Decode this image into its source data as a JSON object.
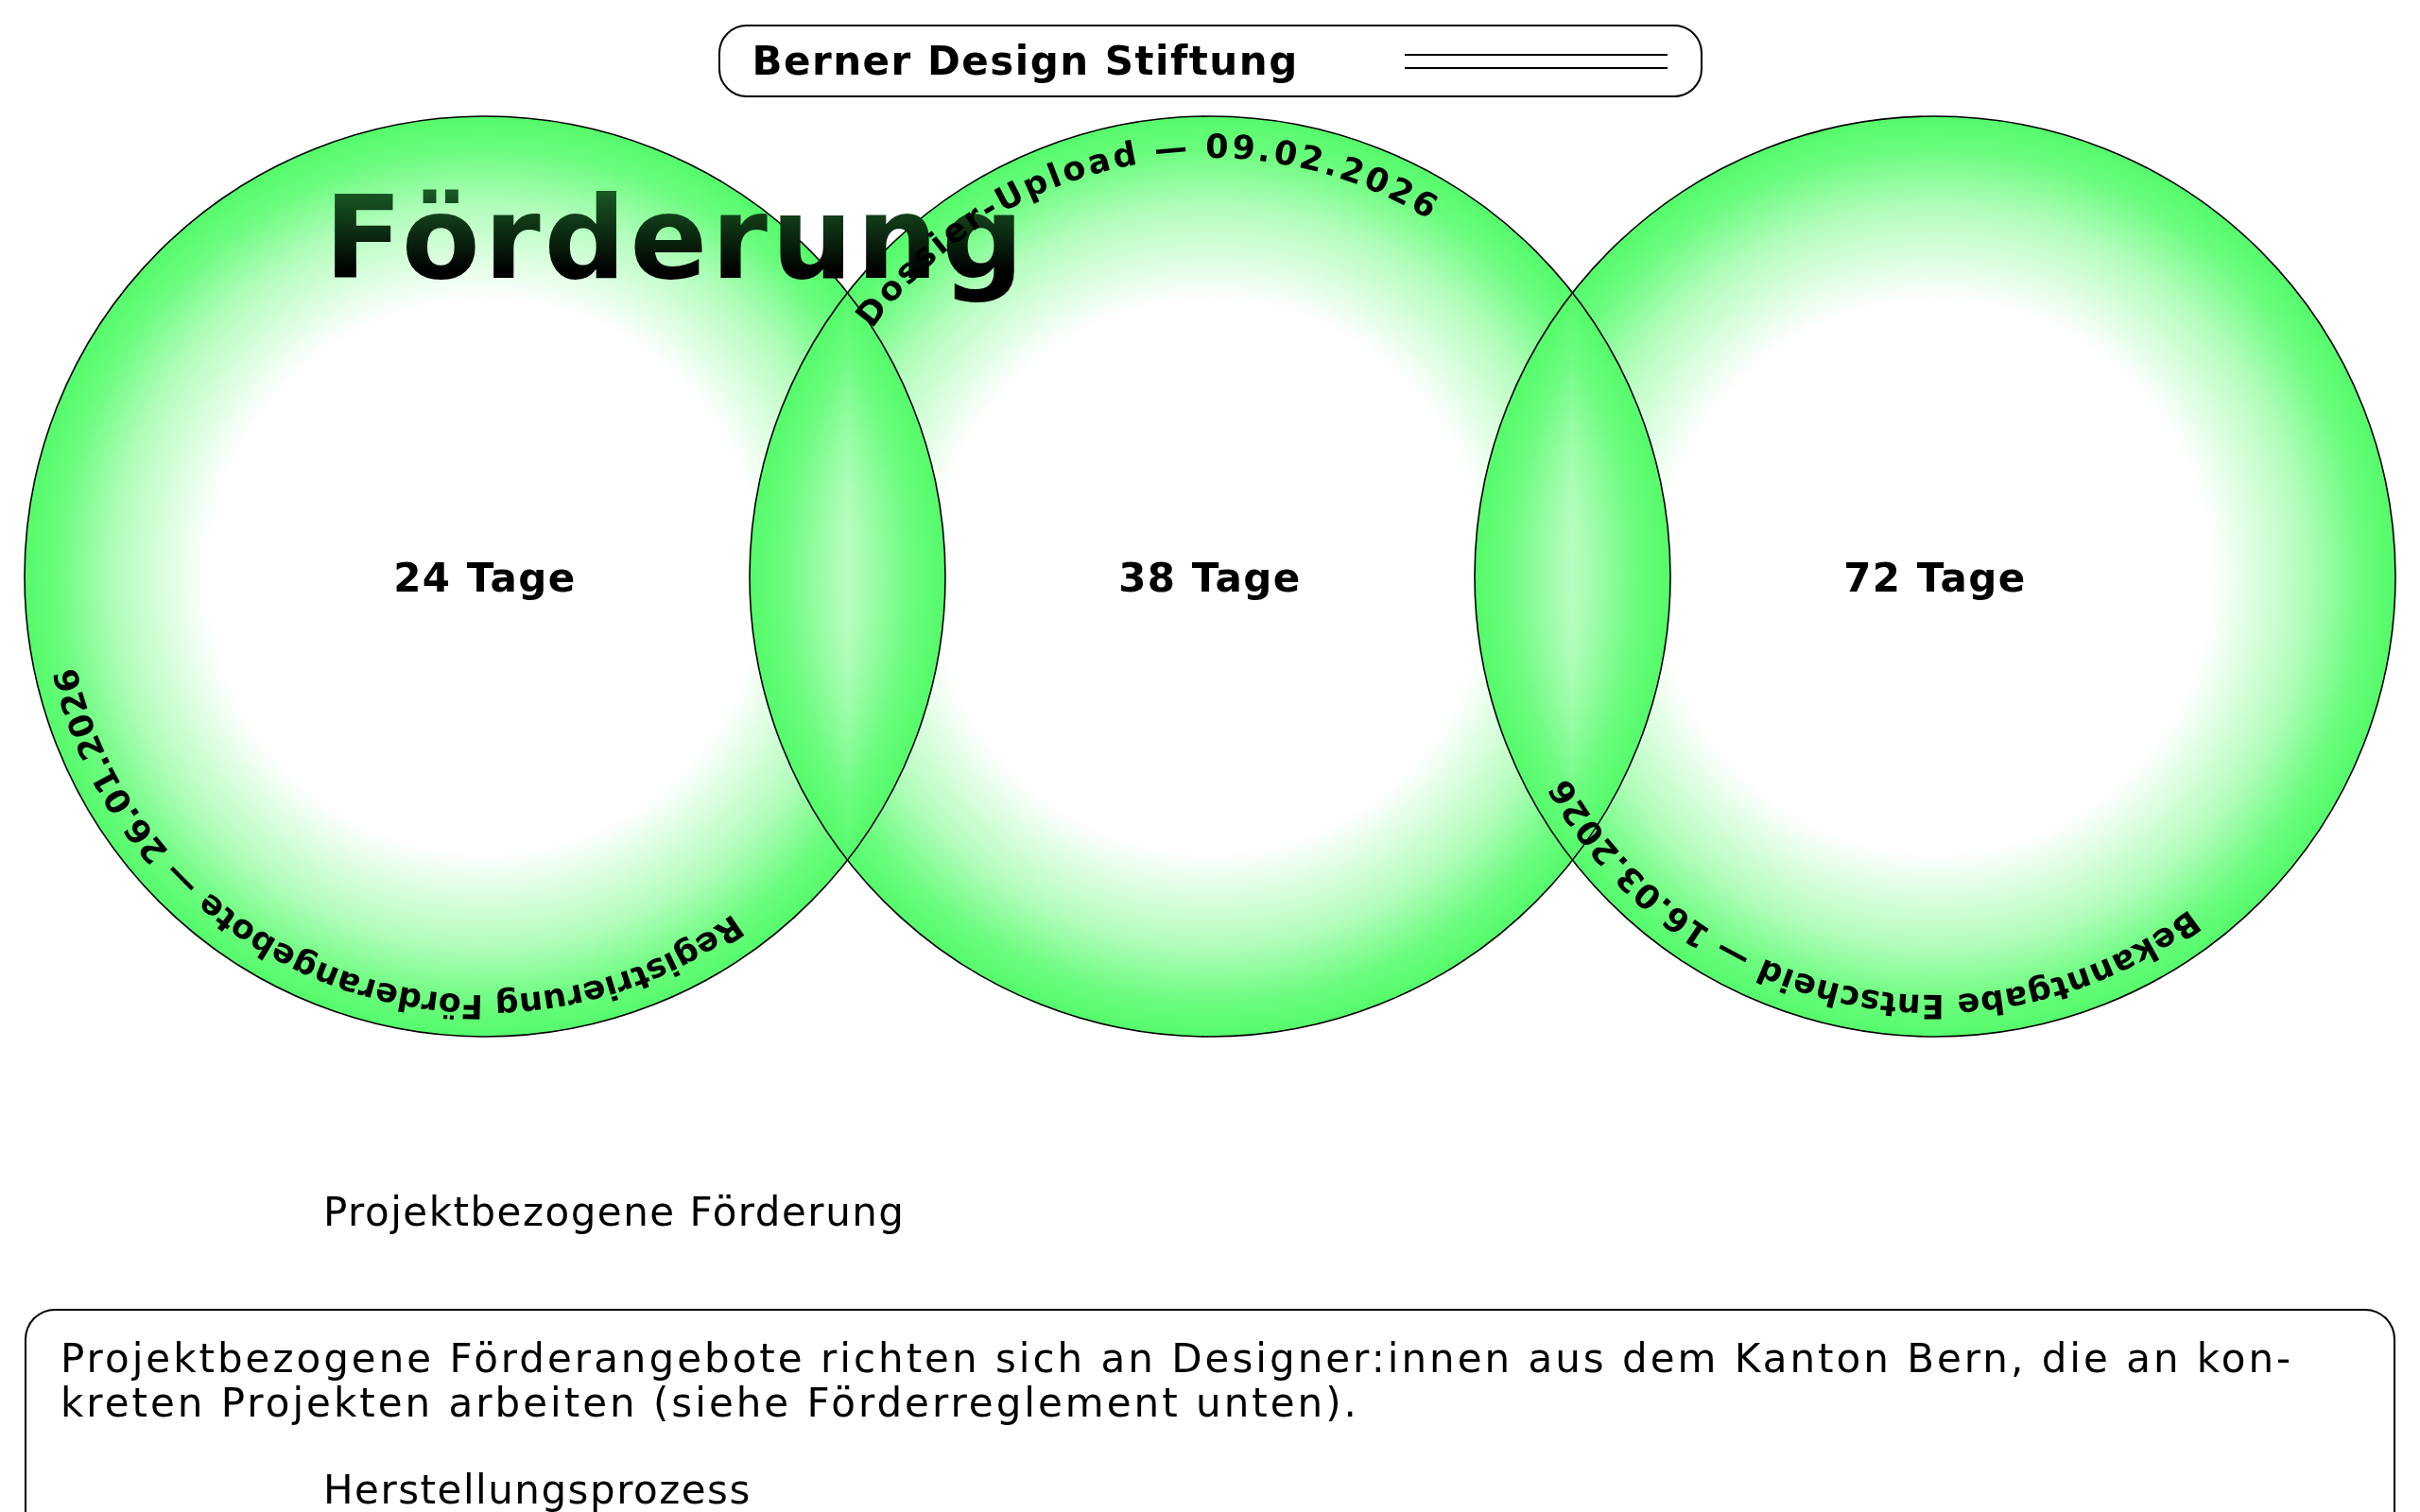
{
  "header": {
    "brand": "Berner Design Stiftung"
  },
  "title": "Förderung",
  "phases": [
    {
      "duration": "24 Tage",
      "milestone": "Registrierung Förderangebote — 26.01.2026"
    },
    {
      "duration": "38 Tage",
      "milestone": "Dossier-Upload — 09.02.2026"
    },
    {
      "duration": "72 Tage",
      "milestone": "Bekanntgabe Entscheid — 16.03.2026"
    }
  ],
  "section": {
    "heading": "Projektbezogene Förderung",
    "panel": {
      "text": "Projektbezogene Förderangebote richten sich an Designer:innen aus dem Kanton Bern, die an kon-kreten Projekten arbeiten (siehe Förderreglement unten).",
      "subheading": "Herstellungsprozess"
    }
  }
}
